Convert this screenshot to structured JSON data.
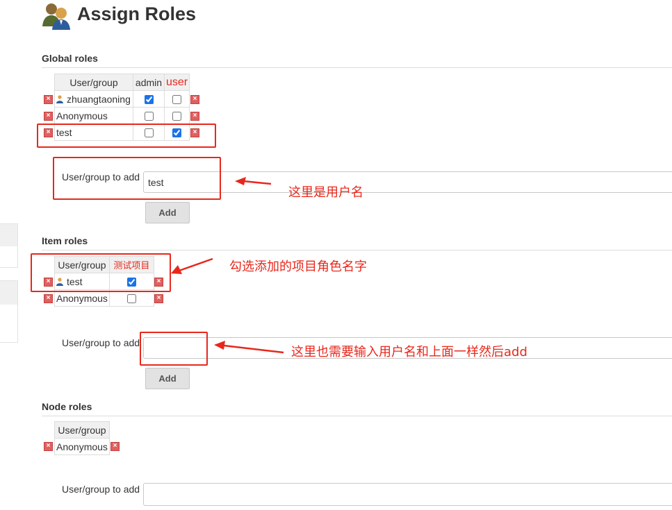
{
  "page": {
    "title": "Assign Roles"
  },
  "global": {
    "heading": "Global roles",
    "col_user": "User/group",
    "roles": [
      "admin",
      "user"
    ],
    "rows": [
      {
        "name": "zhuangtaoning",
        "is_user": true,
        "checks": [
          true,
          false
        ]
      },
      {
        "name": "Anonymous",
        "is_user": false,
        "checks": [
          false,
          false
        ]
      },
      {
        "name": "test",
        "is_user": false,
        "checks": [
          false,
          true
        ]
      }
    ],
    "add_label": "User/group to add",
    "add_value": "test",
    "add_button": "Add"
  },
  "item": {
    "heading": "Item roles",
    "col_user": "User/group",
    "roles": [
      "测试项目"
    ],
    "rows": [
      {
        "name": "test",
        "is_user": true,
        "checks": [
          true
        ]
      },
      {
        "name": "Anonymous",
        "is_user": false,
        "checks": [
          false
        ]
      }
    ],
    "add_label": "User/group to add",
    "add_value": "",
    "add_button": "Add"
  },
  "node": {
    "heading": "Node roles",
    "col_user": "User/group",
    "rows": [
      {
        "name": "Anonymous"
      }
    ],
    "add_label": "User/group to add",
    "add_value": ""
  },
  "annotations": {
    "username_note": "这里是用户名",
    "item_note": "勾选添加的项目角色名字",
    "item_add_note": "这里也需要输入用户名和上面一样然后add"
  },
  "colors": {
    "annotation": "#e8271b",
    "checkbox": "#1a73e8",
    "delete": "#e06060"
  }
}
